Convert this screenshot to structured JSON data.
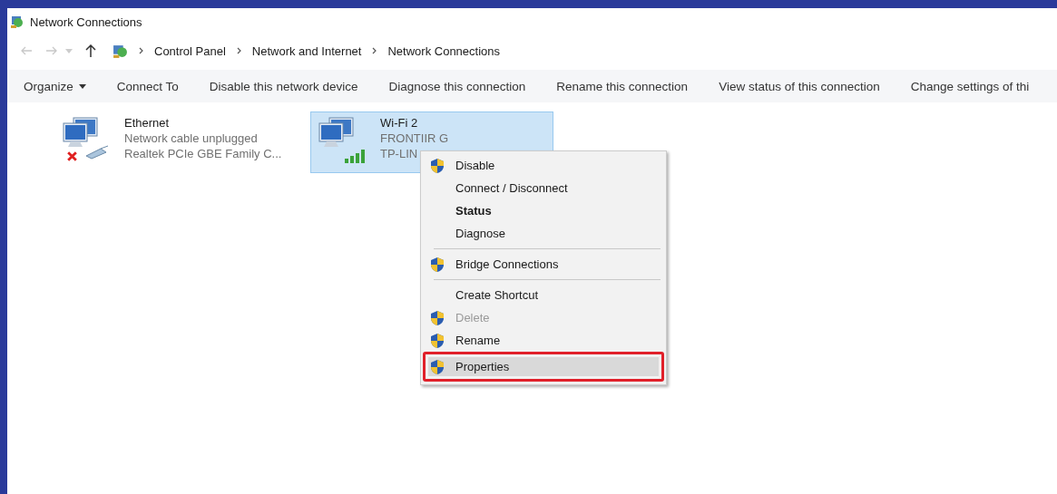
{
  "window": {
    "title": "Network Connections"
  },
  "address_bar": {
    "back_disabled": true,
    "forward_disabled": true,
    "path": [
      "Control Panel",
      "Network and Internet",
      "Network Connections"
    ]
  },
  "toolbar": [
    {
      "label": "Organize",
      "dropdown": true
    },
    {
      "label": "Connect To",
      "dropdown": false
    },
    {
      "label": "Disable this network device",
      "dropdown": false
    },
    {
      "label": "Diagnose this connection",
      "dropdown": false
    },
    {
      "label": "Rename this connection",
      "dropdown": false
    },
    {
      "label": "View status of this connection",
      "dropdown": false
    },
    {
      "label": "Change settings of thi",
      "dropdown": false
    }
  ],
  "connections": [
    {
      "kind": "ethernet",
      "name": "Ethernet",
      "status": "Network cable unplugged",
      "device": "Realtek PCIe GBE Family C...",
      "disconnected": true,
      "selected": false
    },
    {
      "kind": "wifi",
      "name": "Wi-Fi 2",
      "status": "FRONTIIR G",
      "device": "TP-LIN",
      "disconnected": false,
      "selected": true
    }
  ],
  "context_menu": {
    "groups": [
      [
        {
          "label": "Disable",
          "shield": true,
          "default": false,
          "disabled": false,
          "selected": false,
          "highlighted": false
        },
        {
          "label": "Connect / Disconnect",
          "shield": false,
          "default": false,
          "disabled": false,
          "selected": false,
          "highlighted": false
        },
        {
          "label": "Status",
          "shield": false,
          "default": true,
          "disabled": false,
          "selected": false,
          "highlighted": false
        },
        {
          "label": "Diagnose",
          "shield": false,
          "default": false,
          "disabled": false,
          "selected": false,
          "highlighted": false
        }
      ],
      [
        {
          "label": "Bridge Connections",
          "shield": true,
          "default": false,
          "disabled": false,
          "selected": false,
          "highlighted": false
        }
      ],
      [
        {
          "label": "Create Shortcut",
          "shield": false,
          "default": false,
          "disabled": false,
          "selected": false,
          "highlighted": false
        },
        {
          "label": "Delete",
          "shield": true,
          "default": false,
          "disabled": true,
          "selected": false,
          "highlighted": false
        },
        {
          "label": "Rename",
          "shield": true,
          "default": false,
          "disabled": false,
          "selected": false,
          "highlighted": false
        },
        {
          "label": "Properties",
          "shield": true,
          "default": false,
          "disabled": false,
          "selected": true,
          "highlighted": true
        }
      ]
    ]
  }
}
